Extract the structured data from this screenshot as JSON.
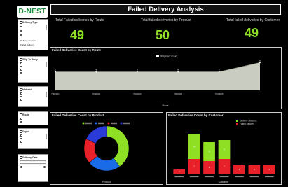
{
  "logo": "D-NEST",
  "title": "Failed Delivery Analysis",
  "kpis": [
    {
      "label": "Total Failed deliveries by Route",
      "value": "49"
    },
    {
      "label": "Total failed deliveries by Product",
      "value": "50"
    },
    {
      "label": "Total failed deliveries by Customer",
      "value": "49"
    }
  ],
  "slicers": {
    "delivery_type": {
      "title": "Delivery Type",
      "rows": [
        "☐",
        "☐",
        "☐"
      ],
      "legend": [
        "Delivery Success",
        "Failed Delivery"
      ]
    },
    "ship_to_party": {
      "title": "Ship To Party"
    },
    "material": {
      "title": "Material"
    },
    "route": {
      "title": "Route"
    },
    "depot": {
      "title": "Depot"
    },
    "delivery_date": {
      "title": "Delivery Date"
    }
  },
  "colors": {
    "green": "#8fe025",
    "red": "#e8202a",
    "blue": "#1a6be8",
    "area_fill": "#c9ccc0",
    "background": "#000000"
  },
  "chart_data": [
    {
      "type": "area",
      "title": "Failed Deliveries Count by Route",
      "legend": [
        "Shipment Count"
      ],
      "categories": [
        "C1",
        "C2",
        "C3",
        "C4",
        "C5",
        "C6"
      ],
      "tick_labels": [
        "7000001",
        "7000002",
        "7000003",
        "7000004",
        "7000005",
        ""
      ],
      "xlabel": "Route",
      "values": [
        6,
        6,
        6,
        6,
        6,
        9
      ],
      "data_labels": [
        "6",
        "6",
        "6",
        "6",
        "6",
        "9"
      ],
      "ylim": [
        0,
        10
      ]
    },
    {
      "type": "pie",
      "title": "Failed Deliveries Count by Product",
      "xlabel": "Product",
      "labels": [
        "P1",
        "P2",
        "P3",
        "P4"
      ],
      "values": [
        20,
        12,
        9,
        9
      ],
      "slice_colors": [
        "#8fe025",
        "#1a6be8",
        "#e8202a",
        "#2a3ad8"
      ]
    },
    {
      "type": "bar",
      "title": "Failed Deliveries Count by Customer",
      "xlabel": "Customer",
      "legend": [
        "Delivery Success",
        "Failed Delivery"
      ],
      "categories": [
        "C1",
        "C2",
        "C3",
        "C4",
        "C5",
        "C6",
        "C7"
      ],
      "series": [
        {
          "name": "Delivery Success",
          "values": [
            0,
            12,
            9,
            9,
            0,
            0,
            0
          ]
        },
        {
          "name": "Failed Delivery",
          "values": [
            2,
            7,
            6,
            7,
            4,
            4,
            4
          ]
        }
      ],
      "ylim": [
        0,
        22
      ]
    }
  ]
}
